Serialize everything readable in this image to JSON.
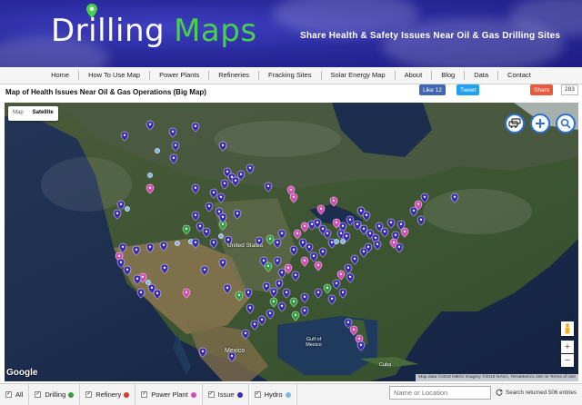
{
  "header": {
    "logo_word1": "Drilling",
    "logo_word2": "Maps",
    "tagline": "Share Health & Safety Issues Near Oil & Gas Drilling Sites"
  },
  "nav": {
    "items": [
      "Home",
      "How To Use Map",
      "Power Plants",
      "Refineries",
      "Fracking Sites",
      "Solar Energy Map",
      "About",
      "Blog",
      "Data",
      "Contact"
    ]
  },
  "page": {
    "title": "Map of Health Issues Near Oil & Gas Operations (Big Map)"
  },
  "social": {
    "like_label": "Like 12",
    "tweet_label": "Tweet",
    "share_label": "Share",
    "share_count": "283"
  },
  "map": {
    "type_map": "Map",
    "type_satellite": "Satellite",
    "labels": {
      "united_states": "United States",
      "mexico": "Mexico",
      "gulf": "Gulf of Mexico",
      "cuba": "Cuba"
    },
    "google": "Google",
    "attribution": "Map data ©2018 INEGI Imagery ©2018 NASA, TerraMetrics   200 mi   Terms of Use",
    "controls": [
      "traffic-icon",
      "add-icon",
      "search-icon"
    ],
    "zoom_in": "+",
    "zoom_out": "−"
  },
  "filters": {
    "all": "All",
    "drilling": "Drilling",
    "refinery": "Refinery",
    "power_plant": "Power Plant",
    "issue": "Issue",
    "hydro": "Hydro",
    "colors": {
      "drilling": "#2e9e3e",
      "refinery": "#d33a2c",
      "power_plant": "#d648b6",
      "issue": "#3a2bb0",
      "hydro": "#7fb6ee"
    },
    "search_placeholder": "Name or Location",
    "returned": "Search returned 506 entries"
  }
}
